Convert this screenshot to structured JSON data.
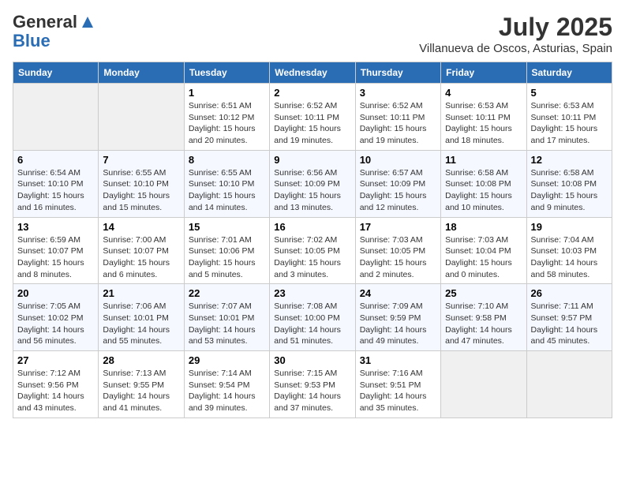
{
  "header": {
    "logo_general": "General",
    "logo_blue": "Blue",
    "month_year": "July 2025",
    "location": "Villanueva de Oscos, Asturias, Spain"
  },
  "days_of_week": [
    "Sunday",
    "Monday",
    "Tuesday",
    "Wednesday",
    "Thursday",
    "Friday",
    "Saturday"
  ],
  "weeks": [
    [
      {
        "day": "",
        "sunrise": "",
        "sunset": "",
        "daylight": ""
      },
      {
        "day": "",
        "sunrise": "",
        "sunset": "",
        "daylight": ""
      },
      {
        "day": "1",
        "sunrise": "Sunrise: 6:51 AM",
        "sunset": "Sunset: 10:12 PM",
        "daylight": "Daylight: 15 hours and 20 minutes."
      },
      {
        "day": "2",
        "sunrise": "Sunrise: 6:52 AM",
        "sunset": "Sunset: 10:11 PM",
        "daylight": "Daylight: 15 hours and 19 minutes."
      },
      {
        "day": "3",
        "sunrise": "Sunrise: 6:52 AM",
        "sunset": "Sunset: 10:11 PM",
        "daylight": "Daylight: 15 hours and 19 minutes."
      },
      {
        "day": "4",
        "sunrise": "Sunrise: 6:53 AM",
        "sunset": "Sunset: 10:11 PM",
        "daylight": "Daylight: 15 hours and 18 minutes."
      },
      {
        "day": "5",
        "sunrise": "Sunrise: 6:53 AM",
        "sunset": "Sunset: 10:11 PM",
        "daylight": "Daylight: 15 hours and 17 minutes."
      }
    ],
    [
      {
        "day": "6",
        "sunrise": "Sunrise: 6:54 AM",
        "sunset": "Sunset: 10:10 PM",
        "daylight": "Daylight: 15 hours and 16 minutes."
      },
      {
        "day": "7",
        "sunrise": "Sunrise: 6:55 AM",
        "sunset": "Sunset: 10:10 PM",
        "daylight": "Daylight: 15 hours and 15 minutes."
      },
      {
        "day": "8",
        "sunrise": "Sunrise: 6:55 AM",
        "sunset": "Sunset: 10:10 PM",
        "daylight": "Daylight: 15 hours and 14 minutes."
      },
      {
        "day": "9",
        "sunrise": "Sunrise: 6:56 AM",
        "sunset": "Sunset: 10:09 PM",
        "daylight": "Daylight: 15 hours and 13 minutes."
      },
      {
        "day": "10",
        "sunrise": "Sunrise: 6:57 AM",
        "sunset": "Sunset: 10:09 PM",
        "daylight": "Daylight: 15 hours and 12 minutes."
      },
      {
        "day": "11",
        "sunrise": "Sunrise: 6:58 AM",
        "sunset": "Sunset: 10:08 PM",
        "daylight": "Daylight: 15 hours and 10 minutes."
      },
      {
        "day": "12",
        "sunrise": "Sunrise: 6:58 AM",
        "sunset": "Sunset: 10:08 PM",
        "daylight": "Daylight: 15 hours and 9 minutes."
      }
    ],
    [
      {
        "day": "13",
        "sunrise": "Sunrise: 6:59 AM",
        "sunset": "Sunset: 10:07 PM",
        "daylight": "Daylight: 15 hours and 8 minutes."
      },
      {
        "day": "14",
        "sunrise": "Sunrise: 7:00 AM",
        "sunset": "Sunset: 10:07 PM",
        "daylight": "Daylight: 15 hours and 6 minutes."
      },
      {
        "day": "15",
        "sunrise": "Sunrise: 7:01 AM",
        "sunset": "Sunset: 10:06 PM",
        "daylight": "Daylight: 15 hours and 5 minutes."
      },
      {
        "day": "16",
        "sunrise": "Sunrise: 7:02 AM",
        "sunset": "Sunset: 10:05 PM",
        "daylight": "Daylight: 15 hours and 3 minutes."
      },
      {
        "day": "17",
        "sunrise": "Sunrise: 7:03 AM",
        "sunset": "Sunset: 10:05 PM",
        "daylight": "Daylight: 15 hours and 2 minutes."
      },
      {
        "day": "18",
        "sunrise": "Sunrise: 7:03 AM",
        "sunset": "Sunset: 10:04 PM",
        "daylight": "Daylight: 15 hours and 0 minutes."
      },
      {
        "day": "19",
        "sunrise": "Sunrise: 7:04 AM",
        "sunset": "Sunset: 10:03 PM",
        "daylight": "Daylight: 14 hours and 58 minutes."
      }
    ],
    [
      {
        "day": "20",
        "sunrise": "Sunrise: 7:05 AM",
        "sunset": "Sunset: 10:02 PM",
        "daylight": "Daylight: 14 hours and 56 minutes."
      },
      {
        "day": "21",
        "sunrise": "Sunrise: 7:06 AM",
        "sunset": "Sunset: 10:01 PM",
        "daylight": "Daylight: 14 hours and 55 minutes."
      },
      {
        "day": "22",
        "sunrise": "Sunrise: 7:07 AM",
        "sunset": "Sunset: 10:01 PM",
        "daylight": "Daylight: 14 hours and 53 minutes."
      },
      {
        "day": "23",
        "sunrise": "Sunrise: 7:08 AM",
        "sunset": "Sunset: 10:00 PM",
        "daylight": "Daylight: 14 hours and 51 minutes."
      },
      {
        "day": "24",
        "sunrise": "Sunrise: 7:09 AM",
        "sunset": "Sunset: 9:59 PM",
        "daylight": "Daylight: 14 hours and 49 minutes."
      },
      {
        "day": "25",
        "sunrise": "Sunrise: 7:10 AM",
        "sunset": "Sunset: 9:58 PM",
        "daylight": "Daylight: 14 hours and 47 minutes."
      },
      {
        "day": "26",
        "sunrise": "Sunrise: 7:11 AM",
        "sunset": "Sunset: 9:57 PM",
        "daylight": "Daylight: 14 hours and 45 minutes."
      }
    ],
    [
      {
        "day": "27",
        "sunrise": "Sunrise: 7:12 AM",
        "sunset": "Sunset: 9:56 PM",
        "daylight": "Daylight: 14 hours and 43 minutes."
      },
      {
        "day": "28",
        "sunrise": "Sunrise: 7:13 AM",
        "sunset": "Sunset: 9:55 PM",
        "daylight": "Daylight: 14 hours and 41 minutes."
      },
      {
        "day": "29",
        "sunrise": "Sunrise: 7:14 AM",
        "sunset": "Sunset: 9:54 PM",
        "daylight": "Daylight: 14 hours and 39 minutes."
      },
      {
        "day": "30",
        "sunrise": "Sunrise: 7:15 AM",
        "sunset": "Sunset: 9:53 PM",
        "daylight": "Daylight: 14 hours and 37 minutes."
      },
      {
        "day": "31",
        "sunrise": "Sunrise: 7:16 AM",
        "sunset": "Sunset: 9:51 PM",
        "daylight": "Daylight: 14 hours and 35 minutes."
      },
      {
        "day": "",
        "sunrise": "",
        "sunset": "",
        "daylight": ""
      },
      {
        "day": "",
        "sunrise": "",
        "sunset": "",
        "daylight": ""
      }
    ]
  ]
}
